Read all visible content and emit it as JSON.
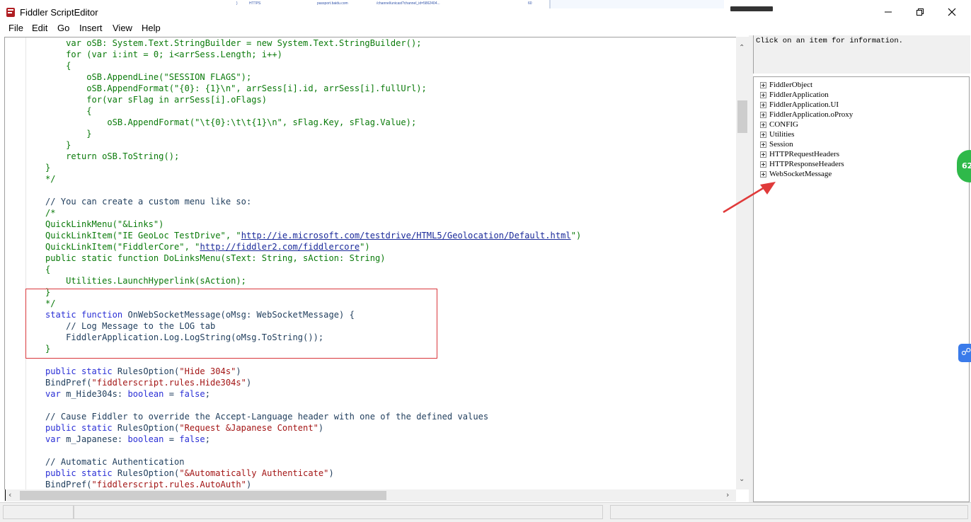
{
  "window": {
    "title": "Fiddler ScriptEditor"
  },
  "background_strip": {
    "col1": "HTTPS",
    "col2": "passport.baidu.com",
    "col3": "/channel/unicast?channel_id=5862404...",
    "col4": "60"
  },
  "menu": [
    {
      "label": "File"
    },
    {
      "label": "Edit"
    },
    {
      "label": "Go"
    },
    {
      "label": "Insert"
    },
    {
      "label": "View"
    },
    {
      "label": "Help"
    }
  ],
  "code_lines": [
    "    var oSB: System.Text.StringBuilder = new System.Text.StringBuilder();",
    "    for (var i:int = 0; i<arrSess.Length; i++)",
    "    {",
    "        oSB.AppendLine(\"SESSION FLAGS\");",
    "        oSB.AppendFormat(\"{0}: {1}\\n\", arrSess[i].id, arrSess[i].fullUrl);",
    "        for(var sFlag in arrSess[i].oFlags)",
    "        {",
    "            oSB.AppendFormat(\"\\t{0}:\\t\\t{1}\\n\", sFlag.Key, sFlag.Value);",
    "        }",
    "    }",
    "    return oSB.ToString();",
    "}",
    "*/",
    "",
    "// You can create a custom menu like so:",
    "/*",
    "QuickLinkMenu(\"&Links\")",
    "QuickLinkItem(\"IE GeoLoc TestDrive\", \"http://ie.microsoft.com/testdrive/HTML5/Geolocation/Default.html\")",
    "QuickLinkItem(\"FiddlerCore\", \"http://fiddler2.com/fiddlercore\")",
    "public static function DoLinksMenu(sText: String, sAction: String)",
    "{",
    "    Utilities.LaunchHyperlink(sAction);",
    "}",
    "*/",
    "static function OnWebSocketMessage(oMsg: WebSocketMessage) {",
    "    // Log Message to the LOG tab",
    "    FiddlerApplication.Log.LogString(oMsg.ToString());",
    "}",
    "",
    "public static RulesOption(\"Hide 304s\")",
    "BindPref(\"fiddlerscript.rules.Hide304s\")",
    "var m_Hide304s: boolean = false;",
    "",
    "// Cause Fiddler to override the Accept-Language header with one of the defined values",
    "public static RulesOption(\"Request &Japanese Content\")",
    "var m_Japanese: boolean = false;",
    "",
    "// Automatic Authentication",
    "public static RulesOption(\"&Automatically Authenticate\")",
    "BindPref(\"fiddlerscript.rules.AutoAuth\")"
  ],
  "info_panel": {
    "text": "Click on an item for information."
  },
  "tree_items": [
    {
      "label": "FiddlerObject"
    },
    {
      "label": "FiddlerApplication"
    },
    {
      "label": "FiddlerApplication.UI"
    },
    {
      "label": "FiddlerApplication.oProxy"
    },
    {
      "label": "CONFIG"
    },
    {
      "label": "Utilities"
    },
    {
      "label": "Session"
    },
    {
      "label": "HTTPRequestHeaders"
    },
    {
      "label": "HTTPResponseHeaders"
    },
    {
      "label": "WebSocketMessage"
    }
  ],
  "overlay": {
    "badge_text": "62"
  },
  "colors": {
    "highlight_box": "#d9373c",
    "annotation_arrow": "#e03a3a",
    "comment_green": "#0a7a0a",
    "keyword_blue": "#2a2fd6",
    "string_red": "#a31515",
    "badge_green": "#2fb94a"
  }
}
